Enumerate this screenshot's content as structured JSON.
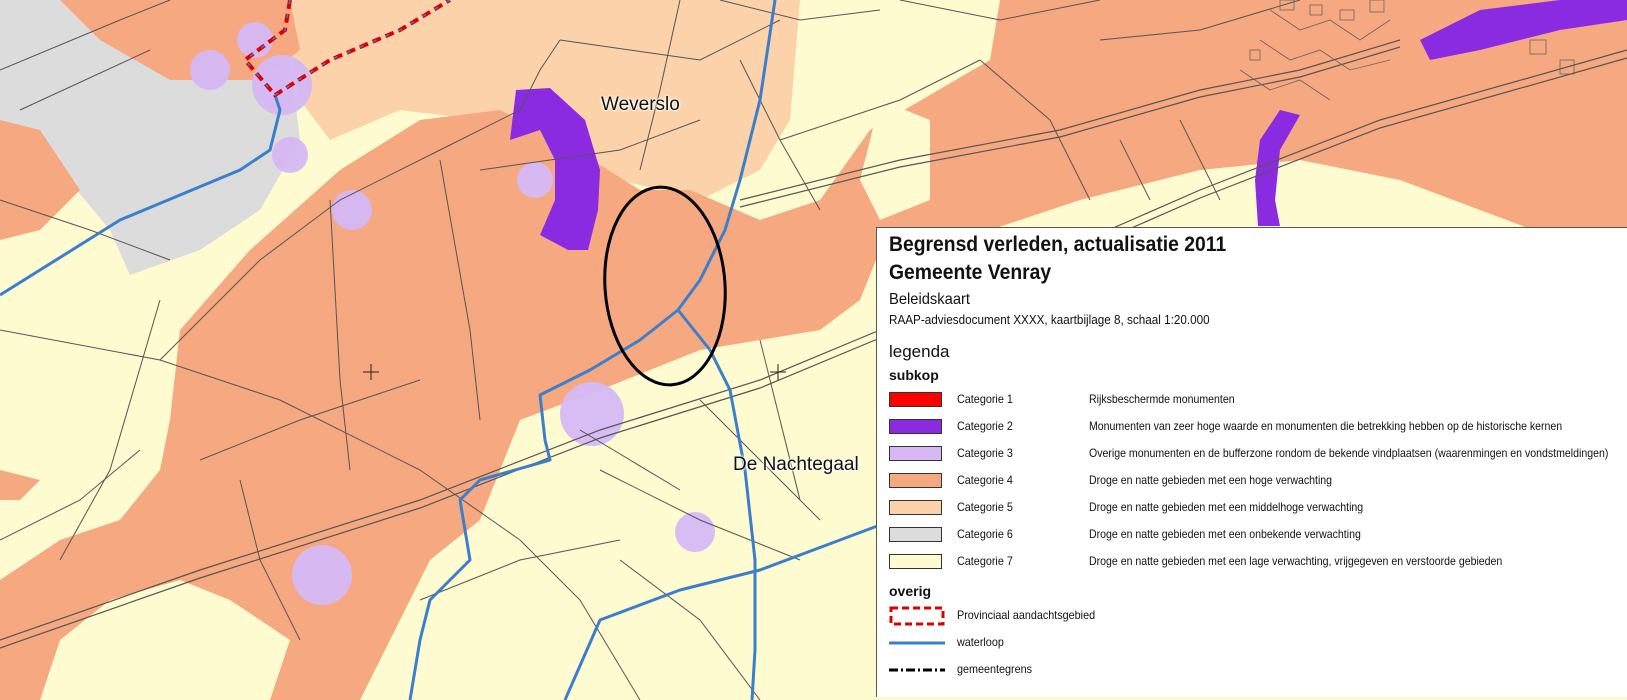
{
  "map": {
    "places": [
      {
        "id": "weverslo",
        "name": "Weverslo"
      },
      {
        "id": "de-nachtegaal",
        "name": "De Nachtegaal"
      }
    ],
    "colors": {
      "background": "#fdfbcf",
      "categorie_1": "#ff0000",
      "categorie_2": "#8a2be2",
      "categorie_3": "#d6b8f5",
      "categorie_4": "#f6a880",
      "categorie_5": "#fbd2a9",
      "categorie_6": "#dcdcdc",
      "categorie_7": "#fdfbcf",
      "waterloop": "#3b7fcc",
      "provinciaal": "#dd0000"
    }
  },
  "legend": {
    "title_line1": "Begrensd verleden, actualisatie 2011",
    "title_line2": "Gemeente Venray",
    "subtitle": "Beleidskaart",
    "document": "RAAP-adviesdocument XXXX, kaartbijlage 8, schaal 1:20.000",
    "heading": "legenda",
    "section_subkop": "subkop",
    "categories": [
      {
        "label": "Categorie 1",
        "description": "Rijksbeschermde monumenten",
        "color": "#ff0000"
      },
      {
        "label": "Categorie 2",
        "description": "Monumenten van zeer hoge waarde en monumenten die betrekking hebben op de historische kernen",
        "color": "#8a2be2"
      },
      {
        "label": "Categorie 3",
        "description": "Overige monumenten en de bufferzone rondom de bekende vindplaatsen (waarenmingen en vondstmeldingen)",
        "color": "#d6b8f5"
      },
      {
        "label": "Categorie 4",
        "description": "Droge en natte gebieden met een hoge verwachting",
        "color": "#f6a880"
      },
      {
        "label": "Categorie 5",
        "description": "Droge en natte gebieden met een middelhoge verwachting",
        "color": "#fbd2a9"
      },
      {
        "label": "Categorie 6",
        "description": "Droge en natte gebieden met een onbekende verwachting",
        "color": "#dcdcdc"
      },
      {
        "label": "Categorie 7",
        "description": "Droge en natte gebieden met een lage verwachting, vrijgegeven en verstoorde gebieden",
        "color": "#fdfbcf"
      }
    ],
    "section_overig": "overig",
    "other": [
      {
        "label": "Provinciaal aandachtsgebied",
        "symbol": "dashed-red-box"
      },
      {
        "label": "waterloop",
        "symbol": "blue-line"
      },
      {
        "label": "gemeentegrens",
        "symbol": "dash-dot-line"
      }
    ]
  }
}
